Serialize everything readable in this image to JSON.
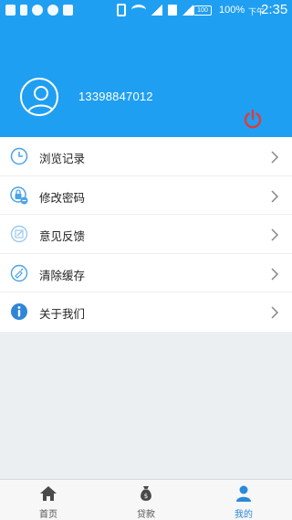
{
  "status_bar": {
    "battery_level": "100",
    "battery_percent": "100%",
    "time_period": "下午",
    "time": "2:35"
  },
  "profile": {
    "phone": "13398847012",
    "avatar_icon": "user-avatar-icon",
    "logout_icon": "power-icon"
  },
  "menu": {
    "items": [
      {
        "label": "浏览记录",
        "icon": "clock-icon"
      },
      {
        "label": "修改密码",
        "icon": "lock-icon"
      },
      {
        "label": "意见反馈",
        "icon": "edit-icon"
      },
      {
        "label": "清除缓存",
        "icon": "clean-icon"
      },
      {
        "label": "关于我们",
        "icon": "info-icon"
      }
    ]
  },
  "bottom_nav": {
    "tabs": [
      {
        "label": "首页",
        "icon": "home-icon",
        "active": false
      },
      {
        "label": "贷款",
        "icon": "money-bag-icon",
        "active": false
      },
      {
        "label": "我的",
        "icon": "person-icon",
        "active": true
      }
    ]
  },
  "colors": {
    "brand_blue": "#1f9ff2",
    "power_red": "#e03a3a",
    "icon_blue": "#4aa3e8",
    "active_tab": "#2a8ad8"
  }
}
